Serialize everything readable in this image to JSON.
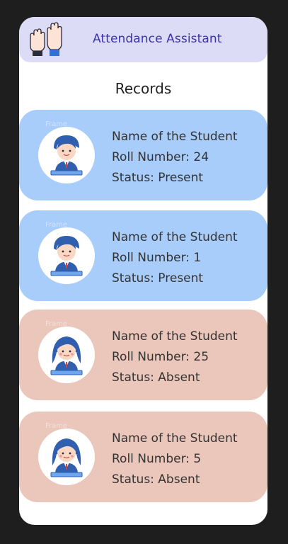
{
  "app_bar": {
    "title": "Attendance Assistant",
    "icon": "raised-hands-icon"
  },
  "section_title": "Records",
  "records": [
    {
      "frame_label": "Frame",
      "name": "Name of the Student",
      "roll": "Roll Number: 24",
      "status": "Status: Present",
      "avatar": "boy-student-icon",
      "color": "#a8cdfb"
    },
    {
      "frame_label": "Frame",
      "name": "Name of the Student",
      "roll": "Roll Number: 1",
      "status": "Status: Present",
      "avatar": "boy-student-icon",
      "color": "#a8cdfb"
    },
    {
      "frame_label": "Frame",
      "name": "Name of the Student",
      "roll": "Roll Number: 25",
      "status": "Status: Absent",
      "avatar": "girl-student-icon",
      "color": "#ebc6bb"
    },
    {
      "frame_label": "Frame",
      "name": "Name of the Student",
      "roll": "Roll Number: 5",
      "status": "Status: Absent",
      "avatar": "girl-student-icon",
      "color": "#ebc6bb"
    }
  ],
  "colors": {
    "app_bar_bg": "#dcdcf7",
    "title_text": "#3b34a8",
    "present_card": "#a8cdfb",
    "absent_card": "#ebc6bb"
  }
}
